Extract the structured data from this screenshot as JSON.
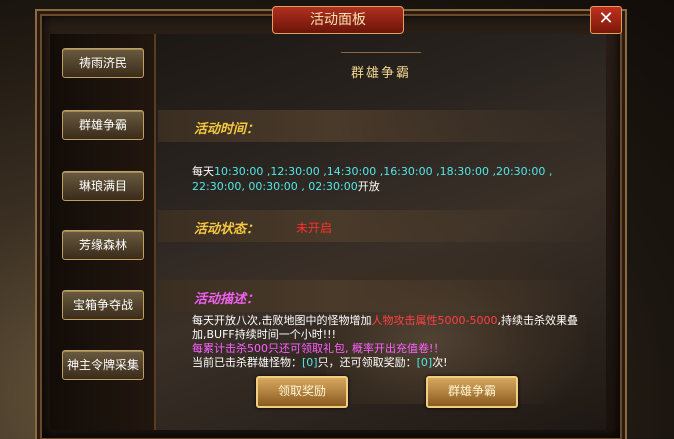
{
  "panel": {
    "title": "活动面板",
    "close_symbol": "✕"
  },
  "sidebar": {
    "items": [
      {
        "label": "祷雨济民"
      },
      {
        "label": "群雄争霸"
      },
      {
        "label": "琳琅满目"
      },
      {
        "label": "芳缘森林"
      },
      {
        "label": "宝箱争夺战"
      },
      {
        "label": "神主令牌采集"
      }
    ]
  },
  "activity": {
    "title": "群雄争霸",
    "time_label": "活动时间：",
    "times_prefix": "每天",
    "times_line1": "10:30:00 ,12:30:00 ,14:30:00 ,16:30:00 ,18:30:00 ,20:30:00 ,",
    "times_line2": "22:30:00, 00:30:00 , 02:30:00",
    "times_suffix": "开放",
    "status_label": "活动状态：",
    "status_value": "未开启",
    "desc_label": "活动描述：",
    "desc_part1": "每天开放八次,击败地图中的怪物增加",
    "desc_highlight": "人物攻击属性5000-5000",
    "desc_part2": ",持续击杀效果叠加,BUFF持续时间一个小时!!!",
    "desc_pink": "每累计击杀500只还可领取礼包, 概率开出充值卷!！",
    "count_prefix": "当前已击杀群雄怪物：",
    "count_value": "[0]",
    "count_mid": "只，还可领取奖励：",
    "reward_value": "[0]",
    "count_suffix": "次!"
  },
  "buttons": {
    "claim": "领取奖励",
    "fight": "群雄争霸"
  }
}
